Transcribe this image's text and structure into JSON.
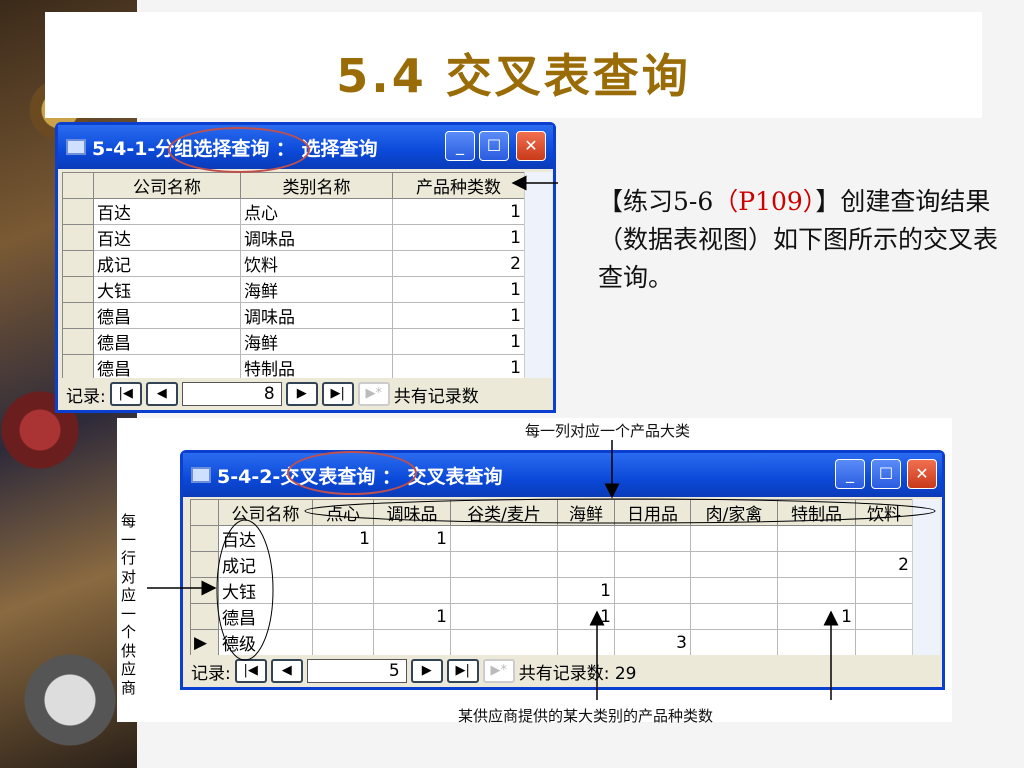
{
  "title": "5.4 交叉表查询",
  "exercise": {
    "p1": "【练习5-6",
    "ref": "（P109）",
    "p2": "】创建查询结果（数据表视图）如下图所示的交叉表查询。"
  },
  "window1": {
    "title": "5-4-1-分组选择查询 ： 选择查询",
    "columns": [
      "公司名称",
      "类别名称",
      "产品种类数"
    ],
    "rows": [
      [
        "百达",
        "点心",
        "1"
      ],
      [
        "百达",
        "调味品",
        "1"
      ],
      [
        "成记",
        "饮料",
        "2"
      ],
      [
        "大钰",
        "海鲜",
        "1"
      ],
      [
        "德昌",
        "调味品",
        "1"
      ],
      [
        "德昌",
        "海鲜",
        "1"
      ],
      [
        "德昌",
        "特制品",
        "1"
      ]
    ],
    "nav": {
      "label": "记录:",
      "current": "8",
      "total_label": "共有记录数"
    }
  },
  "window2": {
    "title": "5-4-2-交叉表查询 ： 交叉表查询",
    "columns": [
      "公司名称",
      "点心",
      "调味品",
      "谷类/麦片",
      "海鲜",
      "日用品",
      "肉/家禽",
      "特制品",
      "饮料"
    ],
    "rows": [
      [
        "百达",
        "1",
        "1",
        "",
        "",
        "",
        "",
        "",
        ""
      ],
      [
        "成记",
        "",
        "",
        "",
        "",
        "",
        "",
        "",
        "2"
      ],
      [
        "大钰",
        "",
        "",
        "",
        "1",
        "",
        "",
        "",
        ""
      ],
      [
        "德昌",
        "",
        "1",
        "",
        "1",
        "",
        "",
        "1",
        ""
      ],
      [
        "德级",
        "",
        "",
        "",
        "",
        "3",
        "",
        "",
        ""
      ]
    ],
    "current_row": 4,
    "nav": {
      "label": "记录:",
      "current": "5",
      "total_label": "共有记录数: 29"
    }
  },
  "annotations": {
    "column": "每一列对应一个产品大类",
    "row": "每一行对应一个供应商",
    "cell": "某供应商提供的某大类别的产品种类数"
  }
}
